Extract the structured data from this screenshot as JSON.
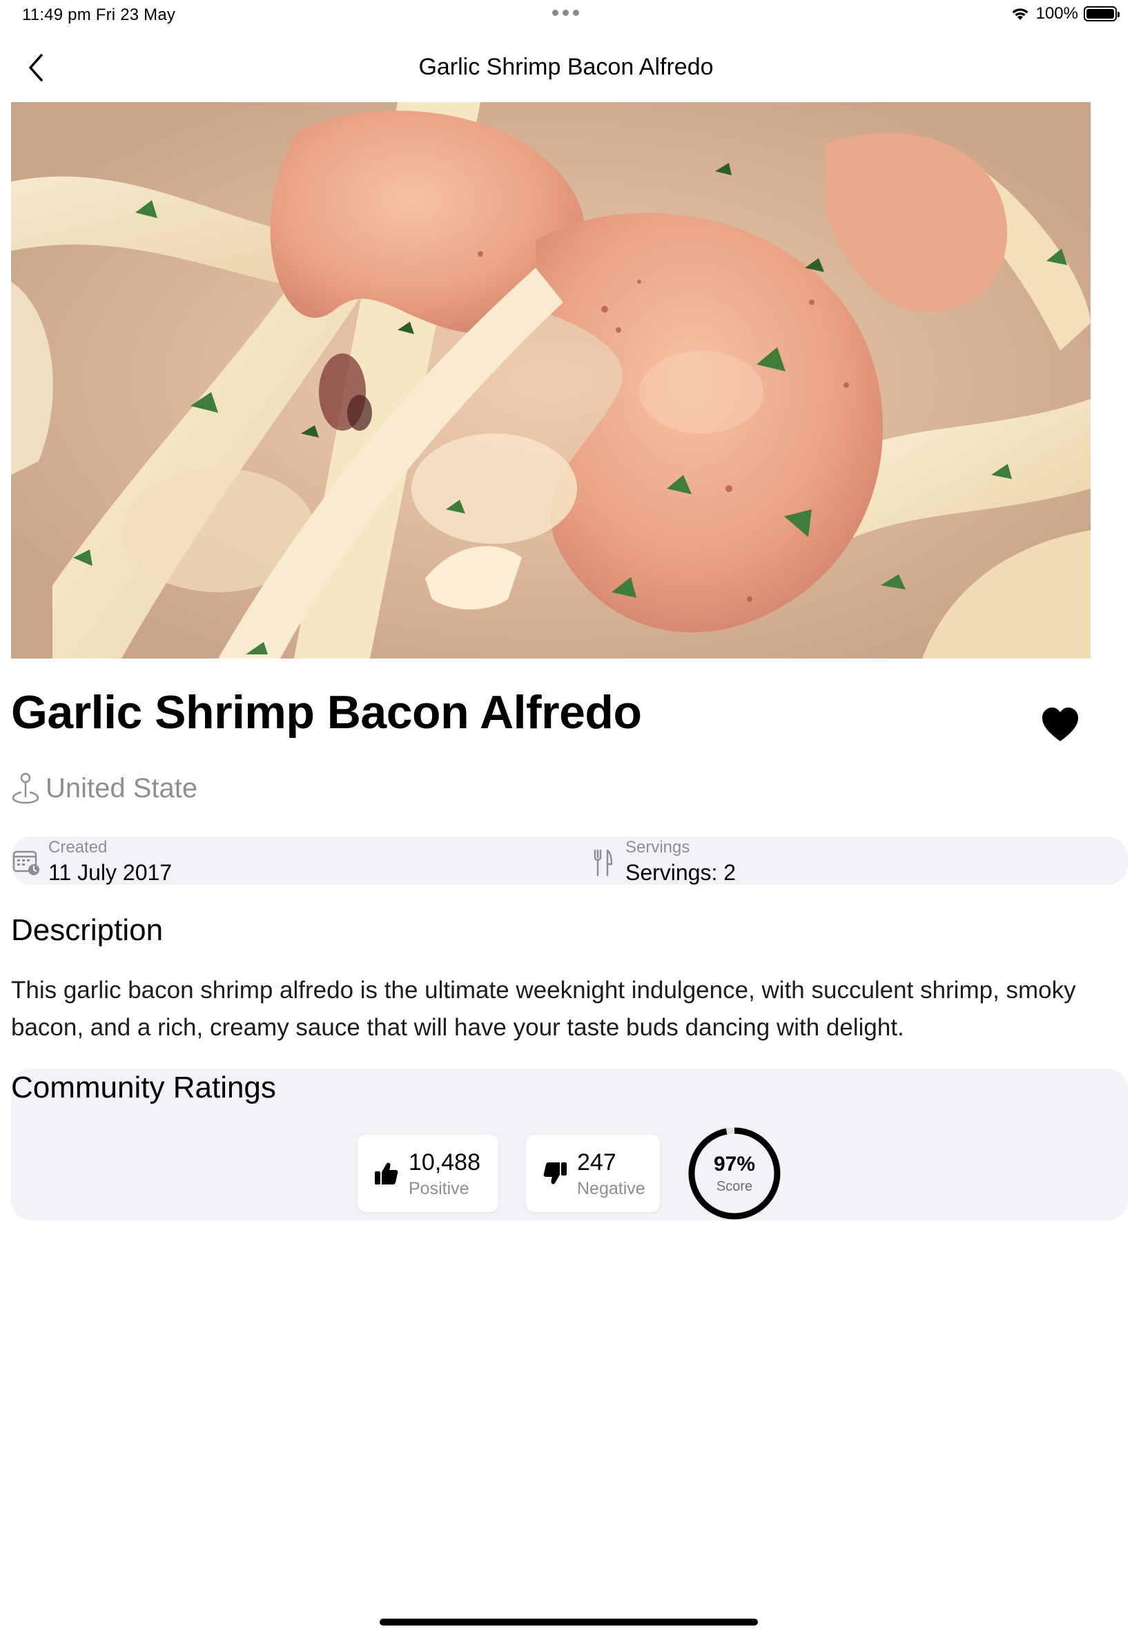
{
  "status_bar": {
    "time": "11:49 pm   Fri 23 May",
    "battery": "100%"
  },
  "nav": {
    "title": "Garlic Shrimp Bacon Alfredo",
    "back_icon": "chevron-left-icon"
  },
  "recipe": {
    "title": "Garlic Shrimp Bacon Alfredo",
    "location": "United State",
    "favorite_icon": "heart-icon"
  },
  "info": {
    "created_label": "Created",
    "created_value": "11 July 2017",
    "servings_label": "Servings",
    "servings_value": "Servings: 2"
  },
  "description": {
    "heading": "Description",
    "text": "This garlic bacon shrimp alfredo is the ultimate weeknight indulgence, with succulent shrimp, smoky bacon, and a rich, creamy sauce that will have your taste buds dancing with delight."
  },
  "ratings": {
    "heading": "Community Ratings",
    "positive_count": "10,488",
    "positive_label": "Positive",
    "negative_count": "247",
    "negative_label": "Negative",
    "score_value": "97%",
    "score_label": "Score",
    "score_fraction": 0.97
  },
  "colors": {
    "panel_bg": "#f2f2f7",
    "secondary_text": "#8e8e93",
    "accent": "#000000"
  }
}
